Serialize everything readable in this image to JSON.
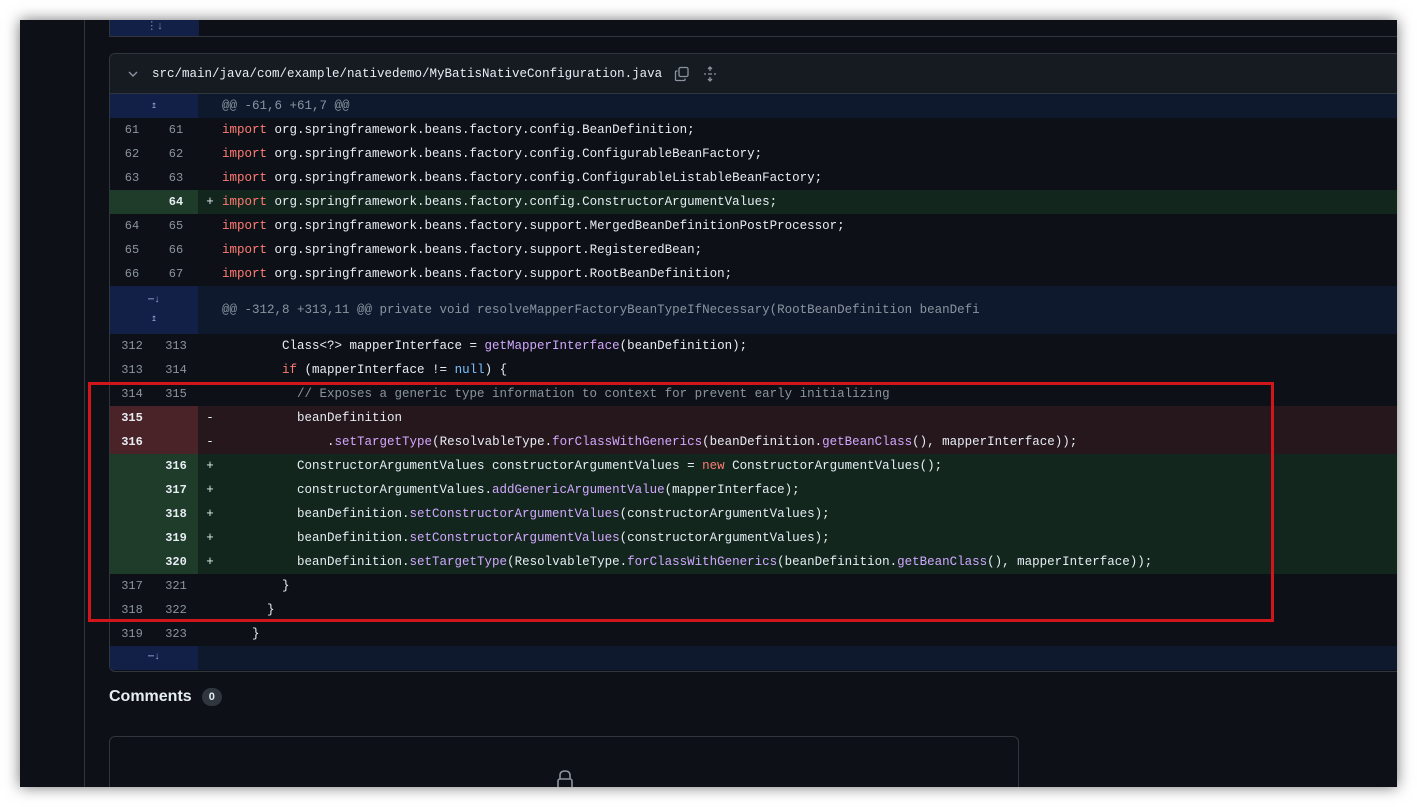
{
  "file": {
    "path": "src/main/java/com/example/nativedemo/MyBatisNativeConfiguration.java"
  },
  "icons": {
    "collapse": "chevron-down-icon",
    "copy": "copy-icon",
    "expand_all": "unfold-icon",
    "expand_up": "expand-up-icon",
    "expand_down": "expand-down-icon",
    "lock": "lock-icon"
  },
  "hunks": {
    "first": "@@ -61,6 +61,7 @@",
    "second": "@@ -312,8 +313,11 @@ private void resolveMapperFactoryBeanTypeIfNecessary(RootBeanDefinition beanDefi"
  },
  "lines": {
    "l61": {
      "old": "61",
      "new": "61",
      "sign": " "
    },
    "l62": {
      "old": "62",
      "new": "62",
      "sign": " "
    },
    "l63": {
      "old": "63",
      "new": "63",
      "sign": " "
    },
    "l64": {
      "old": "",
      "new": "64",
      "sign": "+"
    },
    "l65": {
      "old": "64",
      "new": "65",
      "sign": " "
    },
    "l66": {
      "old": "65",
      "new": "66",
      "sign": " "
    },
    "l67": {
      "old": "66",
      "new": "67",
      "sign": " "
    },
    "l313": {
      "old": "312",
      "new": "313",
      "sign": " "
    },
    "l314": {
      "old": "313",
      "new": "314",
      "sign": " "
    },
    "l315": {
      "old": "314",
      "new": "315",
      "sign": " "
    },
    "d315": {
      "old": "315",
      "new": "",
      "sign": "-"
    },
    "d316": {
      "old": "316",
      "new": "",
      "sign": "-"
    },
    "a316": {
      "old": "",
      "new": "316",
      "sign": "+"
    },
    "a317": {
      "old": "",
      "new": "317",
      "sign": "+"
    },
    "a318": {
      "old": "",
      "new": "318",
      "sign": "+"
    },
    "a319": {
      "old": "",
      "new": "319",
      "sign": "+"
    },
    "a320": {
      "old": "",
      "new": "320",
      "sign": "+"
    },
    "l321": {
      "old": "317",
      "new": "321",
      "sign": " "
    },
    "l322": {
      "old": "318",
      "new": "322",
      "sign": " "
    },
    "l323": {
      "old": "319",
      "new": "323",
      "sign": " "
    }
  },
  "tokens": {
    "import": "import",
    "new": "new",
    "if": "if",
    "null": "null",
    "c61": " org.springframework.beans.factory.config.BeanDefinition;",
    "c62": " org.springframework.beans.factory.config.ConfigurableBeanFactory;",
    "c63": " org.springframework.beans.factory.config.ConfigurableListableBeanFactory;",
    "c64": " org.springframework.beans.factory.config.ConstructorArgumentValues;",
    "c65": " org.springframework.beans.factory.support.MergedBeanDefinitionPostProcessor;",
    "c66": " org.springframework.beans.factory.support.RegisteredBean;",
    "c67": " org.springframework.beans.factory.support.RootBeanDefinition;",
    "c313a": "        Class<?> mapperInterface = ",
    "getMapperInterface": "getMapperInterface",
    "c313b": "(beanDefinition);",
    "c314a": "        ",
    "c314b": " (mapperInterface != ",
    "c314c": ") {",
    "c315": "          // Exposes a generic type information to context for prevent early initializing",
    "d315": "          beanDefinition",
    "d316a": "              .",
    "setTargetType": "setTargetType",
    "d316b": "(ResolvableType.",
    "forClassWithGenerics": "forClassWithGenerics",
    "d316c": "(beanDefinition.",
    "getBeanClass": "getBeanClass",
    "d316d": "(), mapperInterface));",
    "a316a": "          ConstructorArgumentValues constructorArgumentValues = ",
    "a316b": " ConstructorArgumentValues();",
    "a317a": "          constructorArgumentValues.",
    "addGenericArgumentValue": "addGenericArgumentValue",
    "a317b": "(mapperInterface);",
    "a318a": "          beanDefinition.",
    "setConstructorArgumentValues": "setConstructorArgumentValues",
    "a318b": "(constructorArgumentValues);",
    "a320a": "          beanDefinition.",
    "c321": "        }",
    "c322": "      }",
    "c323": "    }"
  },
  "comments": {
    "title": "Comments",
    "count": "0"
  }
}
